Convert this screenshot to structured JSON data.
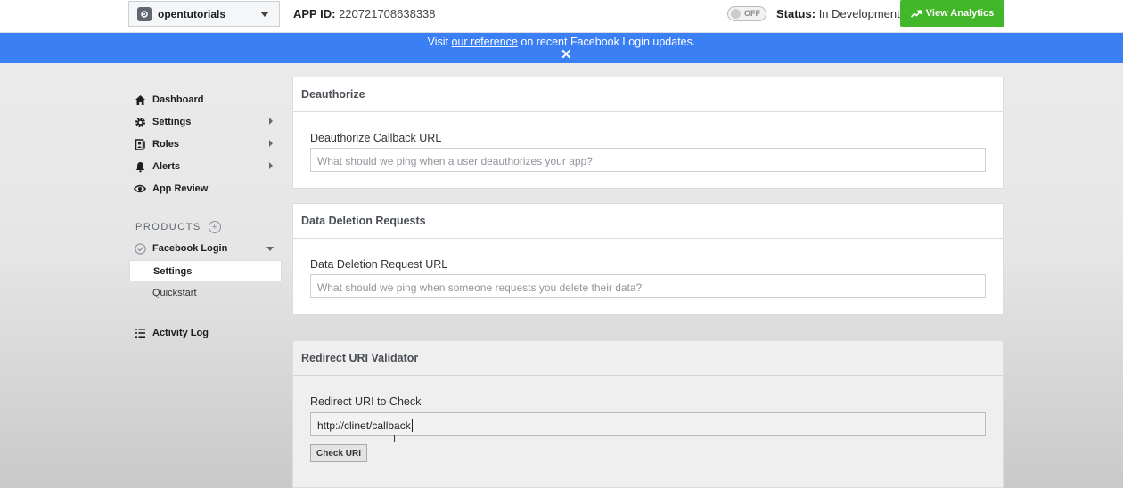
{
  "topbar": {
    "app_name": "opentutorials",
    "app_id_label": "APP ID:",
    "app_id_value": "220721708638338",
    "toggle_label": "OFF",
    "status_label": "Status:",
    "status_value": "In Development",
    "analytics_button": "View Analytics"
  },
  "banner": {
    "prefix": "Visit ",
    "link": "our reference",
    "suffix": " on recent Facebook Login updates.",
    "close": "✕"
  },
  "sidebar": {
    "items": [
      {
        "label": "Dashboard",
        "icon": "home-icon"
      },
      {
        "label": "Settings",
        "icon": "gear-icon"
      },
      {
        "label": "Roles",
        "icon": "roles-icon"
      },
      {
        "label": "Alerts",
        "icon": "bell-icon"
      },
      {
        "label": "App Review",
        "icon": "eye-icon"
      }
    ],
    "products_header": "PRODUCTS",
    "product": "Facebook Login",
    "sub_items": [
      "Settings",
      "Quickstart"
    ],
    "activity_log": "Activity Log"
  },
  "deauthorize": {
    "title": "Deauthorize",
    "field_label": "Deauthorize Callback URL",
    "placeholder": "What should we ping when a user deauthorizes your app?"
  },
  "data_deletion": {
    "title": "Data Deletion Requests",
    "field_label": "Data Deletion Request URL",
    "placeholder": "What should we ping when someone requests you delete their data?"
  },
  "redirect_validator": {
    "title": "Redirect URI Validator",
    "field_label": "Redirect URI to Check",
    "value": "http://clinet/callback",
    "button": "Check URI"
  },
  "colors": {
    "banner": "#3b7ff5",
    "analytics_button": "#42b72a"
  }
}
